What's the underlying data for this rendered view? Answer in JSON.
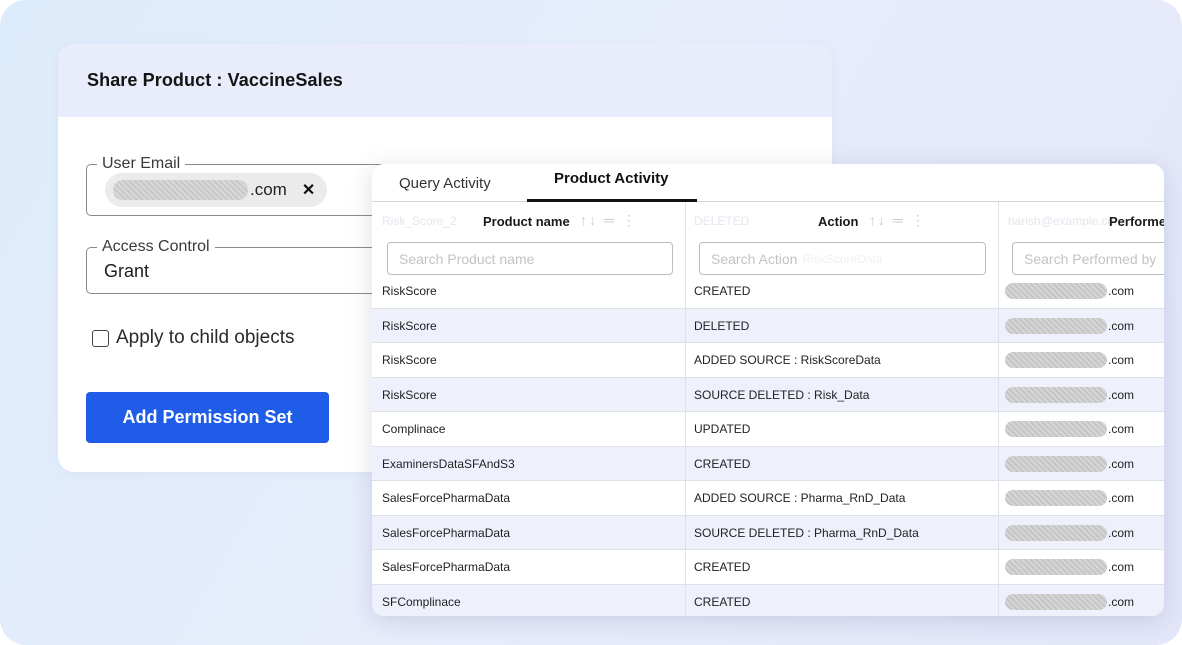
{
  "share": {
    "title": "Share Product : VaccineSales",
    "email_label": "User Email",
    "email_chip_suffix": ".com",
    "chip_remove": "✕",
    "access_label": "Access Control",
    "access_value": "Grant",
    "checkbox_label": "Apply to child objects",
    "add_button": "Add Permission Set"
  },
  "activity": {
    "tabs": [
      {
        "label": "Query Activity"
      },
      {
        "label": "Product Activity"
      }
    ],
    "active_tab": "Product Activity",
    "columns": [
      {
        "title": "Product name",
        "ghost": "Risk_Score_2",
        "search_placeholder": "Search Product name"
      },
      {
        "title": "Action",
        "ghost": "DELETED",
        "search_placeholder": "Search Action",
        "search_ghost": "RiskScoreData"
      },
      {
        "title": "Performe",
        "ghost": "harish@example.com",
        "search_placeholder": "Search Performed by"
      }
    ],
    "sort_icon": "↑↓",
    "menu_icon": "═",
    "more_icon": "⋮",
    "email_suffix": ".com",
    "rows": [
      {
        "product": "RiskScore",
        "action": "CREATED"
      },
      {
        "product": "RiskScore",
        "action": "DELETED"
      },
      {
        "product": "RiskScore",
        "action": "ADDED SOURCE : RiskScoreData"
      },
      {
        "product": "RiskScore",
        "action": "SOURCE DELETED : Risk_Data"
      },
      {
        "product": "Complinace",
        "action": "UPDATED"
      },
      {
        "product": "ExaminersDataSFAndS3",
        "action": "CREATED"
      },
      {
        "product": "SalesForcePharmaData",
        "action": "ADDED SOURCE : Pharma_RnD_Data"
      },
      {
        "product": "SalesForcePharmaData",
        "action": "SOURCE DELETED : Pharma_RnD_Data"
      },
      {
        "product": "SalesForcePharmaData",
        "action": "CREATED"
      },
      {
        "product": "SFComplinace",
        "action": "CREATED"
      }
    ]
  }
}
